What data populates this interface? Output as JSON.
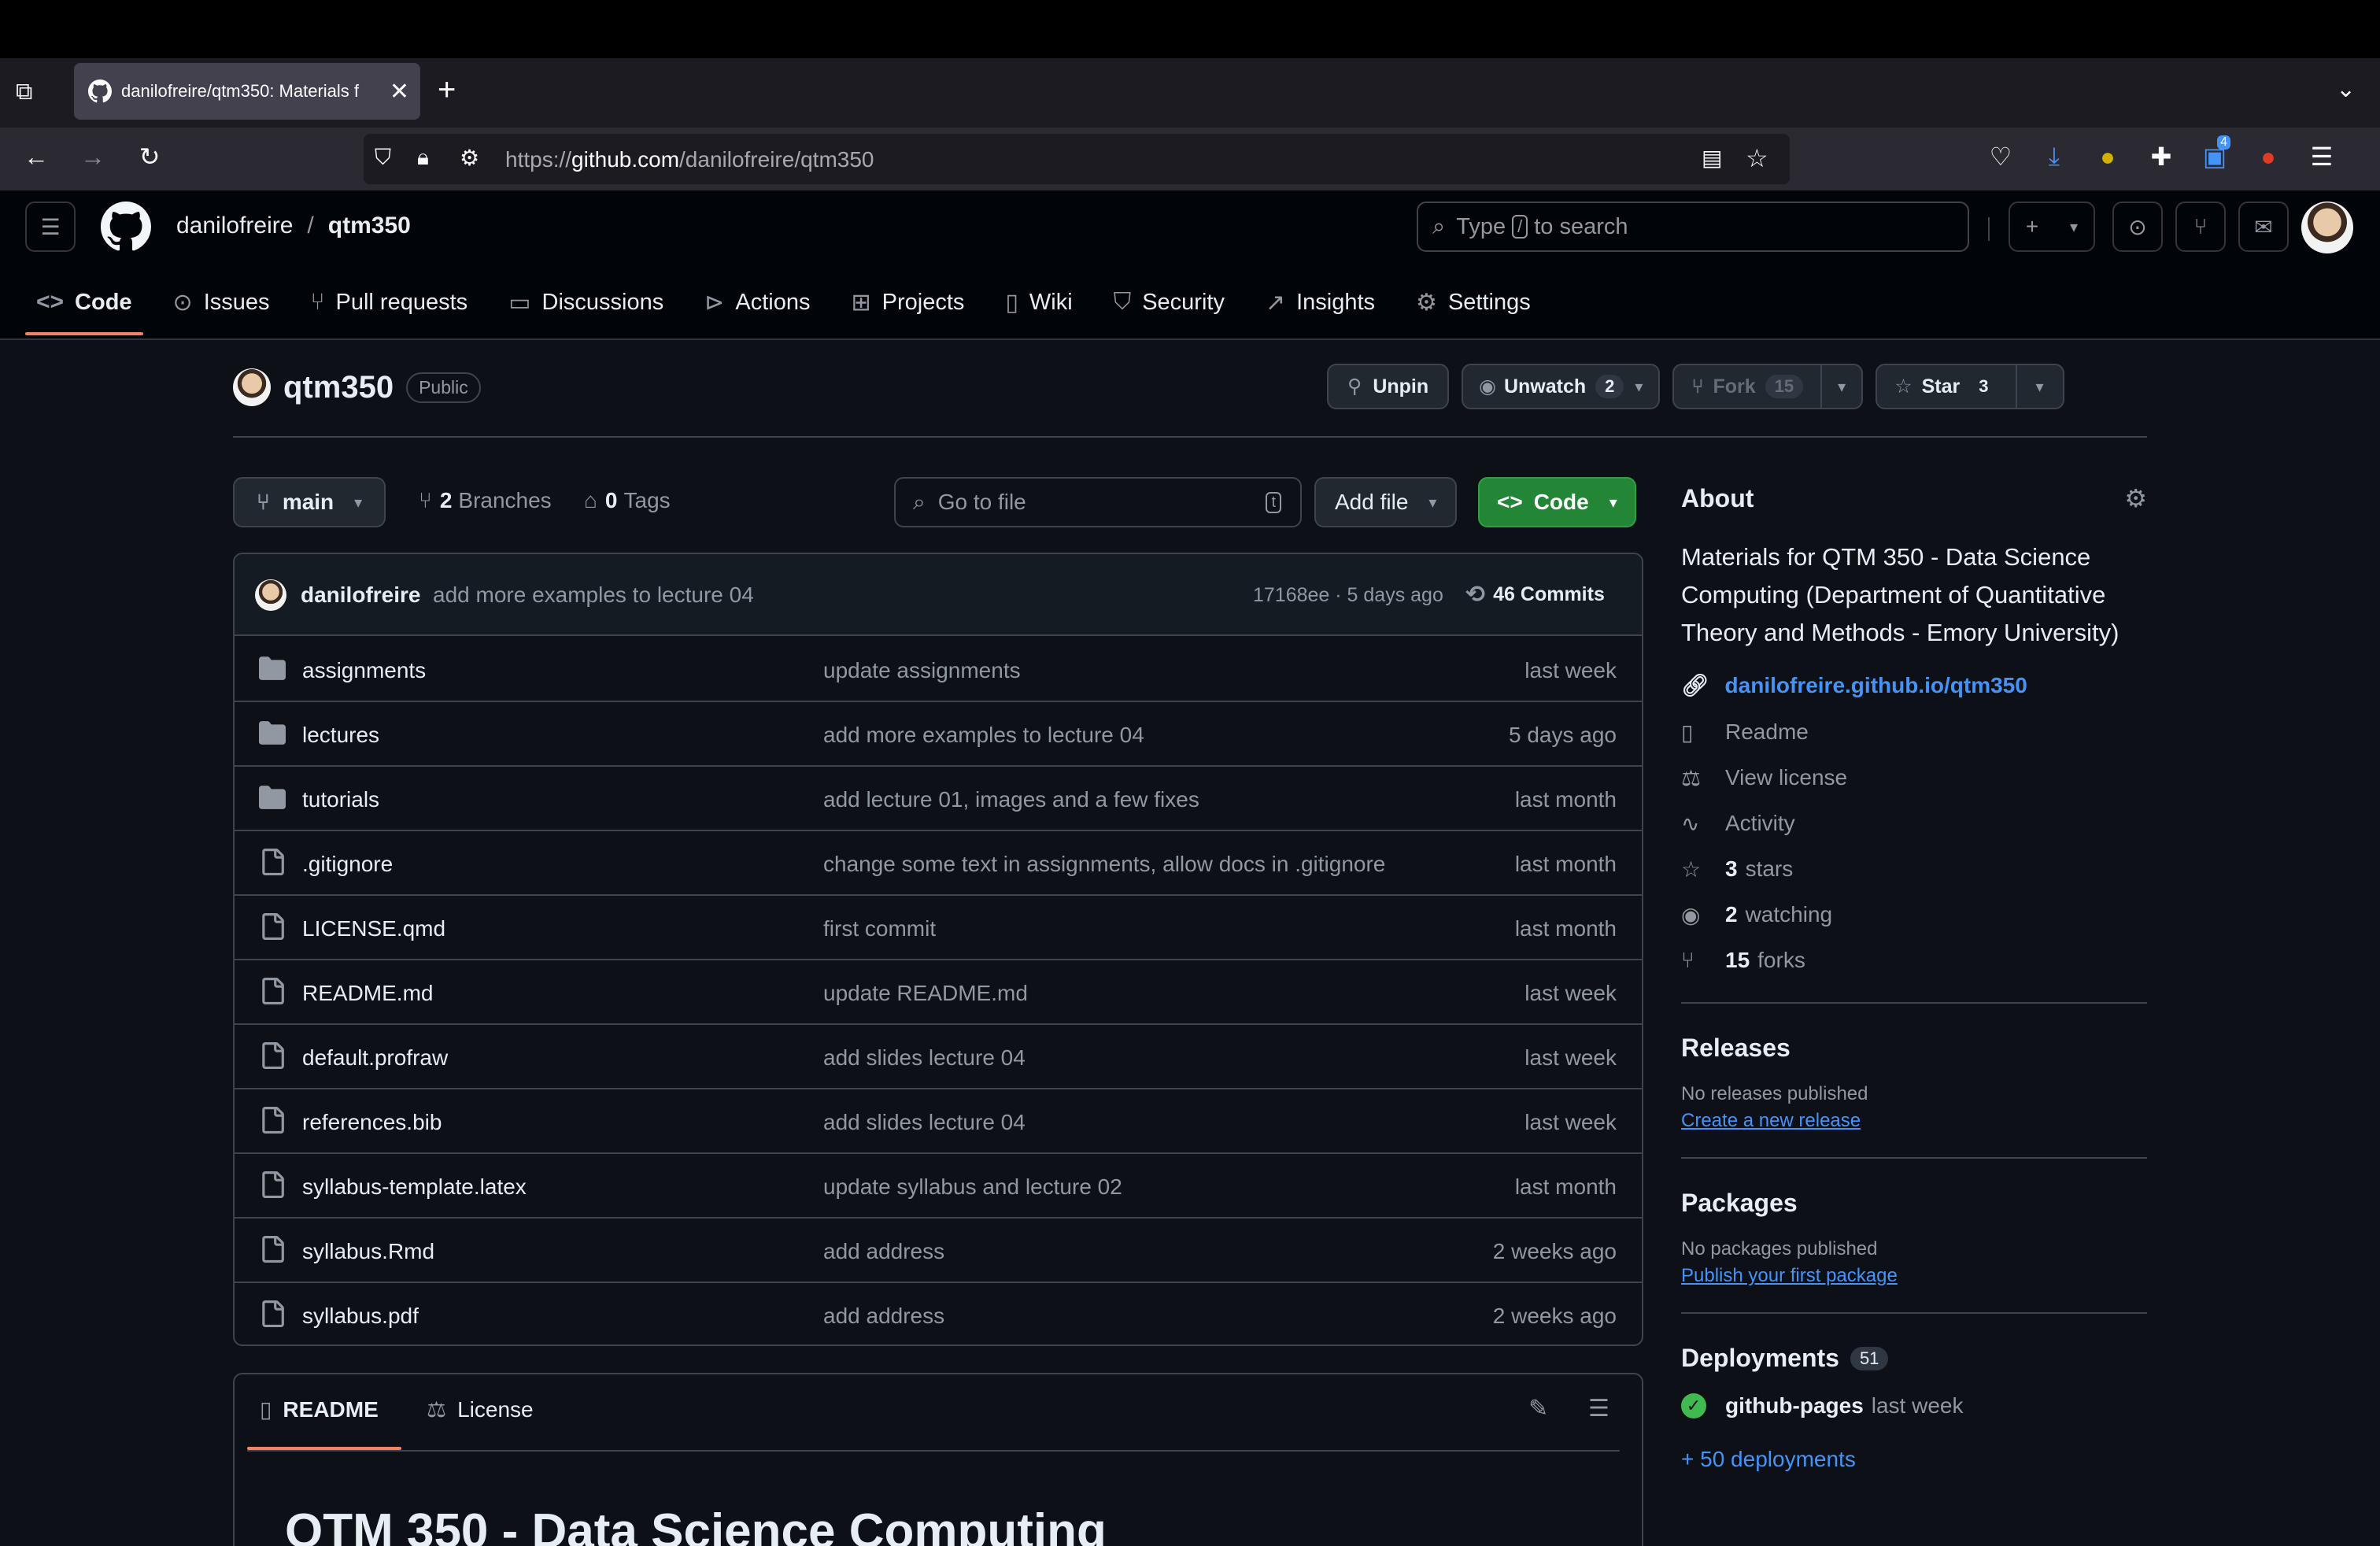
{
  "browser": {
    "tab_title": "danilofreire/qtm350: Materials f",
    "url_prefix": "https://",
    "url_host": "github.com",
    "url_path": "/danilofreire/qtm350",
    "ext_badge": "4"
  },
  "header": {
    "owner": "danilofreire",
    "separator": "/",
    "repo": "qtm350",
    "search_type": "Type",
    "search_key": "/",
    "search_rest": "to search"
  },
  "nav": {
    "tabs": [
      {
        "label": "Code",
        "icon": "code-icon"
      },
      {
        "label": "Issues",
        "icon": "issue-icon"
      },
      {
        "label": "Pull requests",
        "icon": "pull-request-icon"
      },
      {
        "label": "Discussions",
        "icon": "discussion-icon"
      },
      {
        "label": "Actions",
        "icon": "play-icon"
      },
      {
        "label": "Projects",
        "icon": "table-icon"
      },
      {
        "label": "Wiki",
        "icon": "book-icon"
      },
      {
        "label": "Security",
        "icon": "shield-icon"
      },
      {
        "label": "Insights",
        "icon": "graph-icon"
      },
      {
        "label": "Settings",
        "icon": "gear-icon"
      }
    ]
  },
  "repo": {
    "name": "qtm350",
    "visibility": "Public",
    "unpin": "Unpin",
    "unwatch": "Unwatch",
    "watch_count": "2",
    "fork": "Fork",
    "fork_count": "15",
    "star": "Star",
    "star_count": "3"
  },
  "bar": {
    "branch": "main",
    "branches_count": "2",
    "branches_label": "Branches",
    "tags_count": "0",
    "tags_label": "Tags",
    "go_to_file": "Go to file",
    "go_to_file_key": "t",
    "add_file": "Add file",
    "code": "Code"
  },
  "commit": {
    "author": "danilofreire",
    "message": "add more examples to lecture 04",
    "sha_time": "17168ee · 5 days ago",
    "commits": "46 Commits"
  },
  "files": [
    {
      "name": "assignments",
      "type": "dir",
      "msg": "update assignments",
      "date": "last week"
    },
    {
      "name": "lectures",
      "type": "dir",
      "msg": "add more examples to lecture 04",
      "date": "5 days ago"
    },
    {
      "name": "tutorials",
      "type": "dir",
      "msg": "add lecture 01, images and a few fixes",
      "date": "last month"
    },
    {
      "name": ".gitignore",
      "type": "file",
      "msg": "change some text in assignments, allow docs in .gitignore",
      "date": "last month"
    },
    {
      "name": "LICENSE.qmd",
      "type": "file",
      "msg": "first commit",
      "date": "last month"
    },
    {
      "name": "README.md",
      "type": "file",
      "msg": "update README.md",
      "date": "last week"
    },
    {
      "name": "default.profraw",
      "type": "file",
      "msg": "add slides lecture 04",
      "date": "last week"
    },
    {
      "name": "references.bib",
      "type": "file",
      "msg": "add slides lecture 04",
      "date": "last week"
    },
    {
      "name": "syllabus-template.latex",
      "type": "file",
      "msg": "update syllabus and lecture 02",
      "date": "last month"
    },
    {
      "name": "syllabus.Rmd",
      "type": "file",
      "msg": "add address",
      "date": "2 weeks ago"
    },
    {
      "name": "syllabus.pdf",
      "type": "file",
      "msg": "add address",
      "date": "2 weeks ago"
    }
  ],
  "readme": {
    "tab_readme": "README",
    "tab_license": "License",
    "title": "QTM 350 - Data Science Computing"
  },
  "about": {
    "heading": "About",
    "description": "Materials for QTM 350 - Data Science Computing (Department of Quantitative Theory and Methods - Emory University)",
    "website": "danilofreire.github.io/qtm350",
    "readme": "Readme",
    "license": "View license",
    "activity": "Activity",
    "stars_n": "3",
    "stars_label": "stars",
    "watching_n": "2",
    "watching_label": "watching",
    "forks_n": "15",
    "forks_label": "forks"
  },
  "releases": {
    "heading": "Releases",
    "none": "No releases published",
    "create": "Create a new release"
  },
  "packages": {
    "heading": "Packages",
    "none": "No packages published",
    "publish": "Publish your first package"
  },
  "deployments": {
    "heading": "Deployments",
    "count": "51",
    "env": "github-pages",
    "when": "last week",
    "more": "+ 50 deployments"
  },
  "colors": {
    "accent_link": "#4493f8",
    "code_button": "#238636",
    "tab_underline": "#f78166",
    "success": "#3fb950"
  }
}
